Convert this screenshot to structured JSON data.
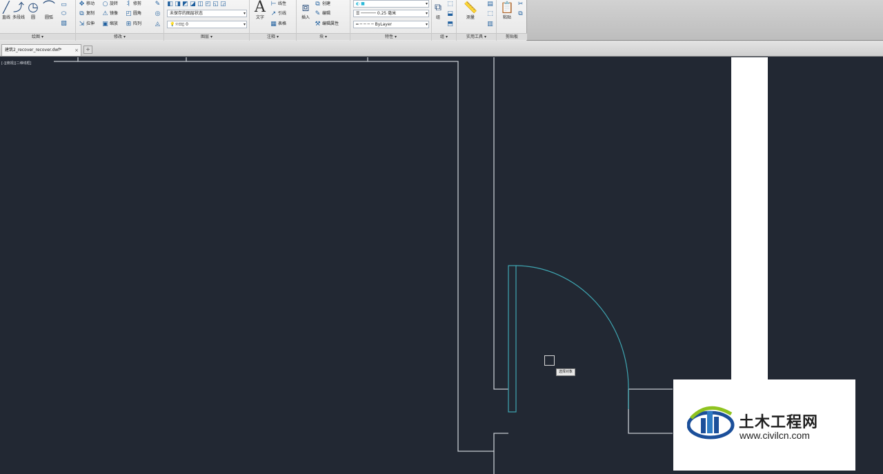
{
  "ribbon": {
    "panels": {
      "draw": {
        "title": "绘图 ▾",
        "tools": {
          "line": "直线",
          "polyline": "多段线",
          "circle": "圆",
          "arc": "圆弧"
        }
      },
      "modify": {
        "title": "修改 ▾",
        "tools": {
          "move": "移动",
          "rotate": "旋转",
          "trim": "修剪",
          "copy": "复制",
          "mirror": "镜像",
          "fillet": "圆角",
          "stretch": "拉伸",
          "scale": "缩放",
          "array": "阵列"
        }
      },
      "layers": {
        "title": "图层 ▾",
        "layer_state": "未保存的图层状态",
        "current_layer": "0"
      },
      "annotation": {
        "title": "注释 ▾",
        "text": "文字",
        "tools": {
          "linear": "线性",
          "leader": "引线",
          "table": "表格"
        }
      },
      "block": {
        "title": "块 ▾",
        "insert": "插入",
        "tools": {
          "create": "创建",
          "edit": "编辑",
          "edit_attr": "编辑属性"
        }
      },
      "properties": {
        "title": "特性 ▾",
        "color": "■",
        "lineweight": "0.25 毫米",
        "linetype": "ByLayer"
      },
      "groups": {
        "title": "组 ▾",
        "group": "组"
      },
      "utilities": {
        "title": "实用工具 ▾",
        "measure": "测量"
      },
      "clipboard": {
        "title": "剪贴板",
        "paste": "粘贴"
      }
    }
  },
  "tabs": {
    "file_tab": "建筑2_recover_recover.dwf*",
    "close": "×",
    "new_tab": "+"
  },
  "viewport": {
    "label": "[-][俯视][二维线框]"
  },
  "cursor_tooltip": "选择对象",
  "watermark": {
    "title_cn": "土木工程网",
    "url": "www.civilcn.com"
  },
  "colors": {
    "canvas": "#222833",
    "wall_line": "#c7ccd2",
    "door_line": "#3fa7b3",
    "accent": "#1f5f9e"
  },
  "icons": {
    "line": "line-icon",
    "circle": "circle-icon",
    "arc": "arc-icon",
    "text": "text-icon",
    "insert": "insert-icon",
    "paste": "paste-icon"
  }
}
